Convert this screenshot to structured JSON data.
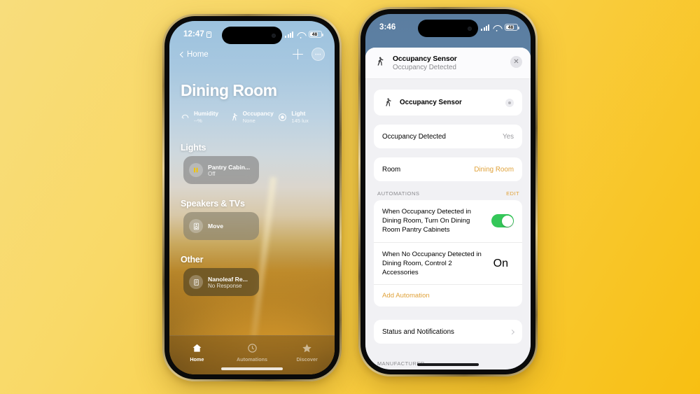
{
  "background": {
    "from": "#f8dd7c",
    "to": "#f8bf12"
  },
  "accent": "#e0a23a",
  "left_phone": {
    "status_bar": {
      "time": "12:47",
      "battery": "48"
    },
    "nav": {
      "back_label": "Home",
      "add_icon": "plus-icon",
      "more_icon": "more-circle-icon"
    },
    "title": "Dining Room",
    "sensors": [
      {
        "icon": "humidity-icon",
        "label": "Humidity",
        "value": "--%"
      },
      {
        "icon": "walking-person-icon",
        "label": "Occupancy",
        "value": "None"
      },
      {
        "icon": "light-sensor-icon",
        "label": "Light",
        "value": "145 lux"
      }
    ],
    "sections": [
      {
        "title": "Lights",
        "tile": {
          "icon": "light-strip-icon",
          "name": "Pantry Cabin...",
          "state": "Off"
        }
      },
      {
        "title": "Speakers & TVs",
        "tile": {
          "icon": "speaker-icon",
          "name": "Move",
          "state": ""
        }
      },
      {
        "title": "Other",
        "tile": {
          "icon": "device-icon",
          "name": "Nanoleaf Re...",
          "state": "No Response"
        }
      }
    ],
    "tabs": [
      {
        "icon": "house-icon",
        "label": "Home",
        "selected": true
      },
      {
        "icon": "clock-icon",
        "label": "Automations",
        "selected": false
      },
      {
        "icon": "star-icon",
        "label": "Discover",
        "selected": false
      }
    ]
  },
  "right_phone": {
    "status_bar": {
      "time": "3:46",
      "battery": "48"
    },
    "sheet_header": {
      "icon": "walking-person-icon",
      "title": "Occupancy Sensor",
      "subtitle": "Occupancy Detected",
      "close_icon": "close-icon"
    },
    "device_row": {
      "icon": "walking-person-icon",
      "name": "Occupancy Sensor",
      "action_icon": "power-icon"
    },
    "detail_rows": [
      {
        "label": "Occupancy Detected",
        "value": "Yes",
        "accent": false
      },
      {
        "label": "Room",
        "value": "Dining Room",
        "accent": true
      }
    ],
    "automations": {
      "header": "AUTOMATIONS",
      "edit_label": "EDIT",
      "items": [
        {
          "text": "When Occupancy Detected in Dining Room, Turn On Dining Room Pantry Cabinets",
          "control": "toggle",
          "toggle_on": true,
          "value": ""
        },
        {
          "text": "When No Occupancy Detected in Dining Room, Control 2 Accessories",
          "control": "disclosure",
          "toggle_on": false,
          "value": "On"
        }
      ],
      "add_label": "Add Automation"
    },
    "status_row": {
      "label": "Status and Notifications"
    },
    "manufacturer_header": "MANUFACTURER"
  }
}
